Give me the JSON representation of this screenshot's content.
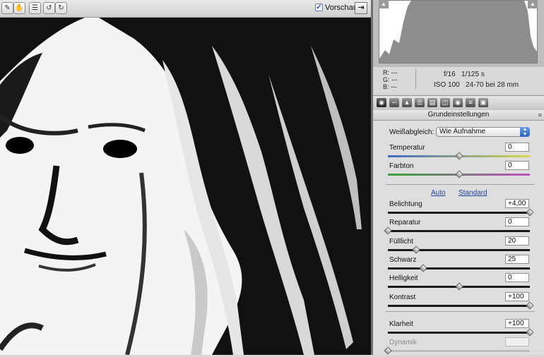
{
  "toolbar": {
    "tools": [
      "brush-tool",
      "hand-tool",
      "list-tool",
      "rotate-left-tool",
      "rotate-right-tool"
    ],
    "preview_label": "Vorschau",
    "preview_checked": true
  },
  "readout": {
    "r_label": "R:",
    "r_value": "---",
    "g_label": "G:",
    "g_value": "---",
    "b_label": "B:",
    "b_value": "---",
    "aperture": "f/16",
    "shutter": "1/125 s",
    "iso": "ISO 100",
    "lens": "24-70 bei 28 mm"
  },
  "section_title": "Grundeinstellungen",
  "white_balance": {
    "label": "Weißabgleich:",
    "value": "Wie Aufnahme"
  },
  "links": {
    "auto": "Auto",
    "standard": "Standard"
  },
  "sliders": [
    {
      "name": "temperature",
      "label": "Temperatur",
      "value": "0",
      "position": 0.5
    },
    {
      "name": "tint",
      "label": "Farbton",
      "value": "0",
      "position": 0.5
    },
    {
      "name": "exposure",
      "label": "Belichtung",
      "value": "+4,00",
      "position": 1.0
    },
    {
      "name": "recovery",
      "label": "Reparatur",
      "value": "0",
      "position": 0.0
    },
    {
      "name": "fill-light",
      "label": "Fülllicht",
      "value": "20",
      "position": 0.2
    },
    {
      "name": "blacks",
      "label": "Schwarz",
      "value": "25",
      "position": 0.25
    },
    {
      "name": "brightness",
      "label": "Helligkeit",
      "value": "0",
      "position": 0.5
    },
    {
      "name": "contrast",
      "label": "Kontrast",
      "value": "+100",
      "position": 1.0
    },
    {
      "name": "clarity",
      "label": "Klarheit",
      "value": "+100",
      "position": 1.0
    },
    {
      "name": "vibrance",
      "label": "Dynamik",
      "value": "",
      "position": 0.0
    }
  ]
}
